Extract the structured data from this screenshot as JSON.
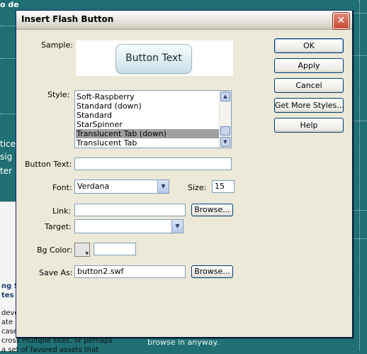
{
  "background": {
    "frag_top": "o de",
    "frag_tice": "tice",
    "frag_sig": "sig",
    "frag_ter": "ter l",
    "panel": [
      "ng S",
      "tes",
      "devel",
      "ate a",
      "case",
      "cross multiple sites, or perhaps",
      "a set of favored assets that"
    ],
    "bottom_right_text": "browse in anyway."
  },
  "dialog": {
    "title": "Insert Flash Button",
    "close_glyph": "✕",
    "sample": {
      "label": "Sample:",
      "button_text": "Button Text"
    },
    "style": {
      "label": "Style:",
      "items": [
        "Soft-Raspberry",
        "Standard (down)",
        "Standard",
        "StarSpinner",
        "Translucent Tab (down)",
        "Translucent Tab"
      ],
      "selected_index": 4
    },
    "button_text": {
      "label": "Button Text:",
      "value": ""
    },
    "font": {
      "label": "Font:",
      "value": "Verdana"
    },
    "size": {
      "label": "Size:",
      "value": "15"
    },
    "link": {
      "label": "Link:",
      "value": "",
      "browse": "Browse..."
    },
    "target": {
      "label": "Target:",
      "value": ""
    },
    "bg_color": {
      "label": "Bg Color:",
      "value": ""
    },
    "save_as": {
      "label": "Save As:",
      "value": "button2.swf",
      "browse": "Browse..."
    },
    "buttons": {
      "ok": "OK",
      "apply": "Apply",
      "cancel": "Cancel",
      "more": "Get More Styles...",
      "help": "Help"
    }
  },
  "colors": {
    "page_bg": "#1f6f73",
    "dialog_bg": "#ece9d8",
    "selection": "#a0a0a0"
  }
}
